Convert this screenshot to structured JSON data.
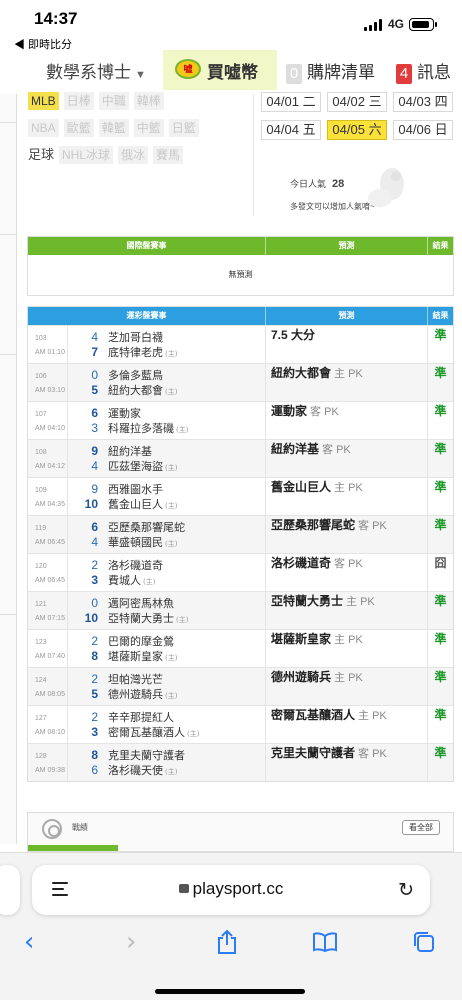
{
  "status": {
    "time": "14:37",
    "back_app": "◀ 即時比分",
    "network": "4G"
  },
  "nav": {
    "user": "數學系博士",
    "coin_icon_text": "噓",
    "coin_label": "買噓幣",
    "cart_count": "0",
    "cart_label": "購牌清單",
    "msg_count": "4",
    "msg_label": "訊息"
  },
  "sports": {
    "row1": [
      "MLB",
      "日棒",
      "中職",
      "韓棒"
    ],
    "row2": [
      "NBA",
      "歐籃",
      "韓籃",
      "中籃",
      "日籃"
    ],
    "row3": [
      "足球",
      "NHL冰球",
      "俄冰",
      "賽馬"
    ],
    "active": "MLB"
  },
  "dates": {
    "row1": [
      "04/01 二",
      "04/02 三",
      "04/03 四"
    ],
    "row2": [
      "04/04 五",
      "04/05 六",
      "04/06 日"
    ],
    "active": "04/05 六"
  },
  "popular": {
    "label": "今日人氣",
    "value": "28",
    "hint": "多發文可以增加人氣唷~"
  },
  "intl": {
    "headers": [
      "國際盤賽事",
      "預測",
      "結果"
    ],
    "empty": "無預測"
  },
  "lottery": {
    "headers": [
      "運彩盤賽事",
      "預測",
      "結果"
    ],
    "home_mark": "(主)",
    "games": [
      {
        "no": "103",
        "time": "AM 01:10",
        "away": "芝加哥白襪",
        "home": "底特律老虎",
        "away_score": "4",
        "home_score": "7",
        "pred": "7.5 大分",
        "tag": "",
        "result": "準"
      },
      {
        "no": "106",
        "time": "AM 03:10",
        "away": "多倫多藍鳥",
        "home": "紐約大都會",
        "away_score": "0",
        "home_score": "5",
        "pred": "紐約大都會",
        "tag": "主 PK",
        "result": "準"
      },
      {
        "no": "107",
        "time": "AM 04:10",
        "away": "運動家",
        "home": "科羅拉多落磯",
        "away_score": "6",
        "home_score": "3",
        "pred": "運動家",
        "tag": "客 PK",
        "result": "準"
      },
      {
        "no": "108",
        "time": "AM 04:12",
        "away": "紐約洋基",
        "home": "匹茲堡海盜",
        "away_score": "9",
        "home_score": "4",
        "pred": "紐約洋基",
        "tag": "客 PK",
        "result": "準"
      },
      {
        "no": "109",
        "time": "AM 04:35",
        "away": "西雅圖水手",
        "home": "舊金山巨人",
        "away_score": "9",
        "home_score": "10",
        "pred": "舊金山巨人",
        "tag": "主 PK",
        "result": "準"
      },
      {
        "no": "119",
        "time": "AM 06:45",
        "away": "亞歷桑那響尾蛇",
        "home": "華盛頓國民",
        "away_score": "6",
        "home_score": "4",
        "pred": "亞歷桑那響尾蛇",
        "tag": "客 PK",
        "result": "準"
      },
      {
        "no": "120",
        "time": "AM 06:45",
        "away": "洛杉磯道奇",
        "home": "費城人",
        "away_score": "2",
        "home_score": "3",
        "pred": "洛杉磯道奇",
        "tag": "客 PK",
        "result": "囧"
      },
      {
        "no": "121",
        "time": "AM 07:15",
        "away": "邁阿密馬林魚",
        "home": "亞特蘭大勇士",
        "away_score": "0",
        "home_score": "10",
        "pred": "亞特蘭大勇士",
        "tag": "主 PK",
        "result": "準"
      },
      {
        "no": "123",
        "time": "AM 07:40",
        "away": "巴爾的摩金鶯",
        "home": "堪薩斯皇家",
        "away_score": "2",
        "home_score": "8",
        "pred": "堪薩斯皇家",
        "tag": "主 PK",
        "result": "準"
      },
      {
        "no": "124",
        "time": "AM 08:05",
        "away": "坦帕灣光芒",
        "home": "德州遊騎兵",
        "away_score": "2",
        "home_score": "5",
        "pred": "德州遊騎兵",
        "tag": "主 PK",
        "result": "準"
      },
      {
        "no": "127",
        "time": "AM 08:10",
        "away": "辛辛那提紅人",
        "home": "密爾瓦基釀酒人",
        "away_score": "2",
        "home_score": "3",
        "pred": "密爾瓦基釀酒人",
        "tag": "主 PK",
        "result": "準"
      },
      {
        "no": "128",
        "time": "AM 09:38",
        "away": "克里夫蘭守護者",
        "home": "洛杉磯天使",
        "away_score": "8",
        "home_score": "6",
        "pred": "克里夫蘭守護者",
        "tag": "客 PK",
        "result": "準"
      }
    ]
  },
  "record": {
    "label": "戰績",
    "view_all": "看全部"
  },
  "safari": {
    "url": "playsport.cc"
  },
  "colors": {
    "intl_header": "#6eb82c",
    "lottery_header": "#2d9ee0",
    "hit": "#1e9a2b",
    "active_date": "#fae23a",
    "link_blue": "#2b7cf6"
  }
}
